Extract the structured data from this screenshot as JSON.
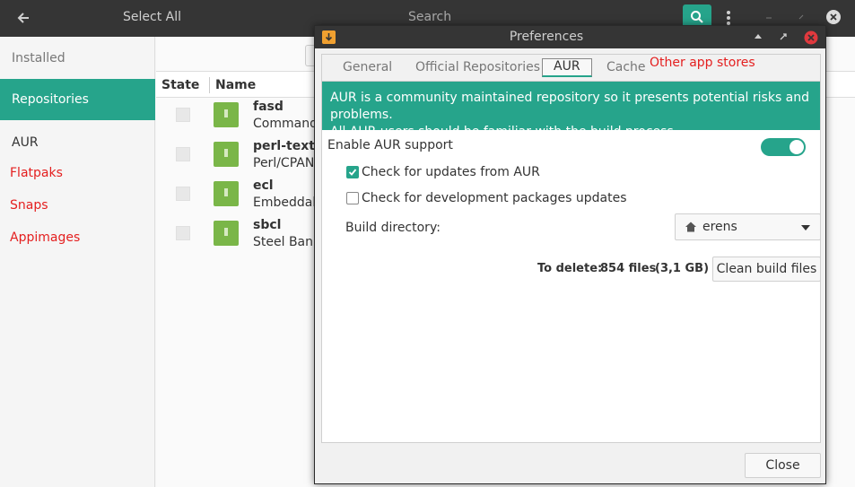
{
  "header": {
    "title": "Select All",
    "search_label": "Search"
  },
  "sidebar": {
    "items": [
      {
        "label": "Installed"
      },
      {
        "label": "Repositories"
      },
      {
        "label": "AUR"
      },
      {
        "label": "Flatpaks"
      },
      {
        "label": "Snaps"
      },
      {
        "label": "Appimages"
      }
    ]
  },
  "list": {
    "columns": {
      "state": "State",
      "name": "Name"
    },
    "packages": [
      {
        "name": "fasd",
        "description": "Command-"
      },
      {
        "name": "perl-text-v",
        "description": "Perl/CPAN"
      },
      {
        "name": "ecl",
        "description": "Embeddabl"
      },
      {
        "name": "sbcl",
        "description": "Steel Bank"
      }
    ]
  },
  "dialog": {
    "title": "Preferences",
    "tabs": [
      "General",
      "Official Repositories",
      "AUR",
      "Cache"
    ],
    "active_tab": "AUR",
    "annotation": "Other app stores",
    "banner_line1": "AUR is a community maintained repository so it presents potential risks and problems.",
    "banner_line2": "All AUR users should be familiar with the build process.",
    "enable_label": "Enable AUR support",
    "enable_on": true,
    "check_updates_label": "Check for updates from AUR",
    "check_updates_checked": true,
    "check_devel_label": "Check for development packages updates",
    "check_devel_checked": false,
    "build_dir_label": "Build directory:",
    "build_dir_value": "erens",
    "to_delete_label": "To delete:",
    "to_delete_files": "854 files",
    "to_delete_size": "(3,1 GB)",
    "clean_button": "Clean build files",
    "close_button": "Close"
  },
  "colors": {
    "accent": "#26a48b",
    "header_bg": "#353535",
    "annotation_red": "#e41f1f",
    "close_red": "#e0393e",
    "package_icon_green": "#7ab648"
  },
  "icons": {
    "back": "arrow-left-icon",
    "search": "magnifier-icon",
    "menu": "vertical-dots-icon",
    "package": "package-box-icon",
    "home": "home-icon"
  }
}
